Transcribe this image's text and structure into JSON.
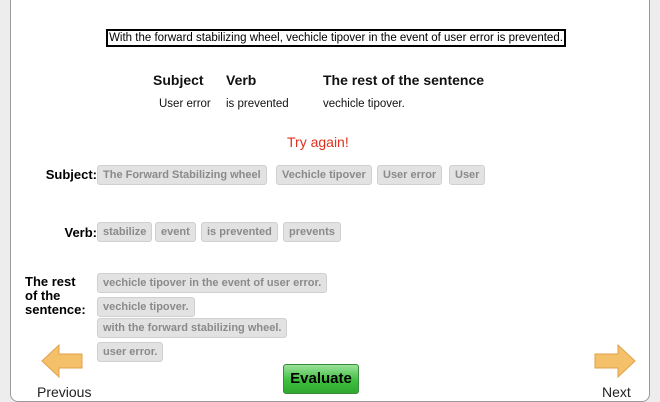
{
  "prompt": "With the forward stabilizing wheel, vechicle tipover in the event of user error is prevented.",
  "answer_table": {
    "headers": {
      "subject": "Subject",
      "verb": "Verb",
      "rest": "The rest of the sentence"
    },
    "values": {
      "subject": "User error",
      "verb": "is prevented",
      "rest": "vechicle tipover."
    }
  },
  "feedback": "Try again!",
  "subject_section": {
    "label": "Subject:",
    "options": [
      "The Forward Stabilizing wheel",
      "Vechicle tipover",
      "User error",
      "User"
    ]
  },
  "verb_section": {
    "label": "Verb:",
    "options": [
      "stabilize",
      "event",
      "is prevented",
      "prevents"
    ]
  },
  "rest_section": {
    "label_line1": "The rest",
    "label_line2": "of the",
    "label_line3": "sentence:",
    "options": [
      "vechicle tipover in the event of user error.",
      "vechicle tipover.",
      "with the forward stabilizing wheel.",
      "user error."
    ]
  },
  "nav": {
    "previous_label": "Previous",
    "next_label": "Next",
    "evaluate_label": "Evaluate"
  },
  "icons": {
    "previous": "left-arrow-icon",
    "next": "right-arrow-icon"
  },
  "colors": {
    "feedback": "#e0301e",
    "evaluate": "#3fbf3f",
    "arrow": "#f5c06a"
  }
}
